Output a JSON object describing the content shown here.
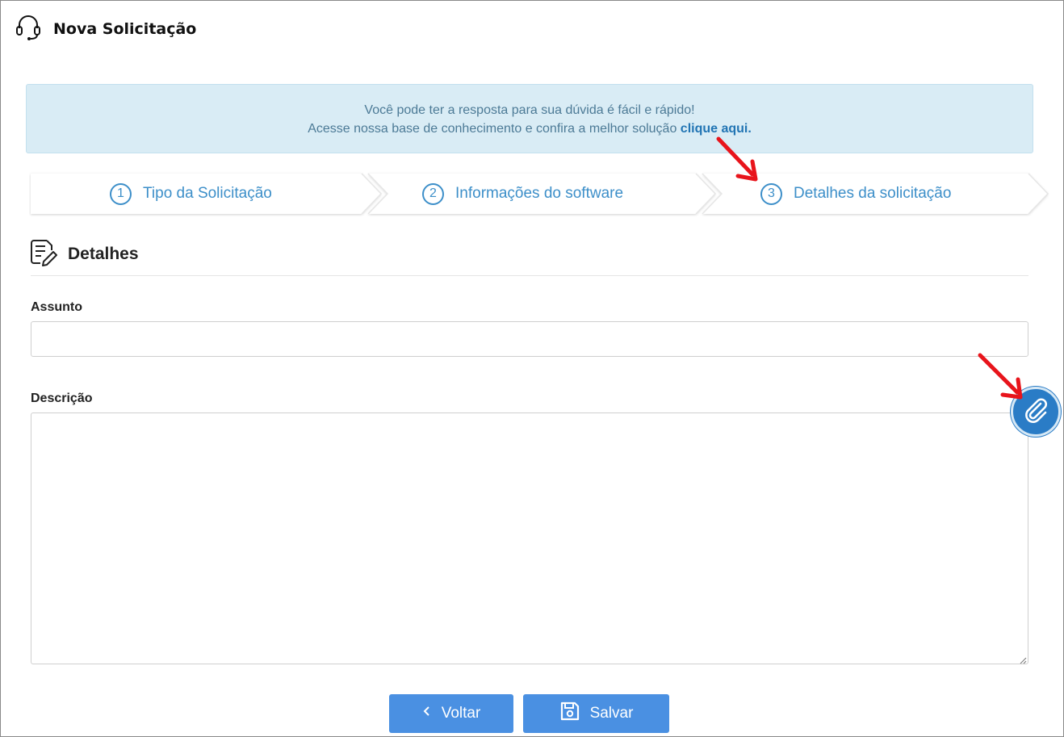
{
  "header": {
    "title": "Nova Solicitação",
    "icon": "headset-icon"
  },
  "info_banner": {
    "line1": "Você pode ter a resposta para sua dúvida é fácil e rápido!",
    "line2": "Acesse nossa base de conhecimento e confira a melhor solução ",
    "link_text": "clique aqui."
  },
  "steps": [
    {
      "number": "1",
      "label": "Tipo da Solicitação"
    },
    {
      "number": "2",
      "label": "Informações do software"
    },
    {
      "number": "3",
      "label": "Detalhes da solicitação"
    }
  ],
  "section": {
    "title": "Detalhes",
    "icon": "document-edit-icon"
  },
  "form": {
    "subject_label": "Assunto",
    "subject_value": "",
    "description_label": "Descrição",
    "description_value": ""
  },
  "buttons": {
    "back_label": "Voltar",
    "save_label": "Salvar"
  },
  "colors": {
    "accent": "#3d8fc9",
    "button": "#4a90e2",
    "banner_bg": "#d9ecf5",
    "annotation_arrow": "#e8141b"
  }
}
